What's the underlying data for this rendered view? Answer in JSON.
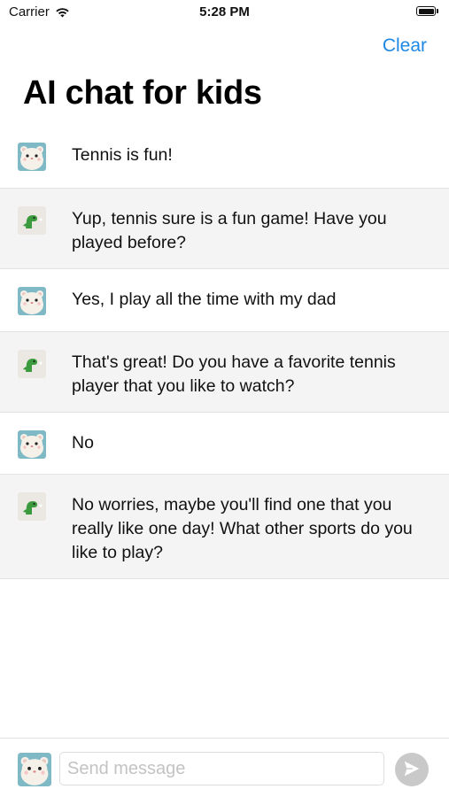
{
  "status_bar": {
    "carrier": "Carrier",
    "time": "5:28 PM",
    "icons": [
      "wifi-icon",
      "battery-icon"
    ]
  },
  "nav": {
    "clear_label": "Clear",
    "title": "AI chat for kids"
  },
  "messages": [
    {
      "sender": "user",
      "avatar": "hamster-avatar",
      "text": "Tennis is fun!"
    },
    {
      "sender": "bot",
      "avatar": "dinosaur-avatar",
      "text": "Yup, tennis sure is a fun game! Have you played before?"
    },
    {
      "sender": "user",
      "avatar": "hamster-avatar",
      "text": "Yes, I play all the time with my dad"
    },
    {
      "sender": "bot",
      "avatar": "dinosaur-avatar",
      "text": "That's great! Do you have a favorite tennis player that you like to watch?"
    },
    {
      "sender": "user",
      "avatar": "hamster-avatar",
      "text": "No"
    },
    {
      "sender": "bot",
      "avatar": "dinosaur-avatar",
      "text": "No worries, maybe you'll find one that you really like one day! What other sports do you like to play?"
    }
  ],
  "input": {
    "placeholder": "Send message",
    "value": "",
    "avatar": "hamster-avatar",
    "send_icon": "send-icon"
  },
  "colors": {
    "accent": "#1e88e5",
    "bot_row_bg": "#f4f4f4",
    "user_row_bg": "#ffffff",
    "send_button_bg": "#c9c9c9"
  }
}
